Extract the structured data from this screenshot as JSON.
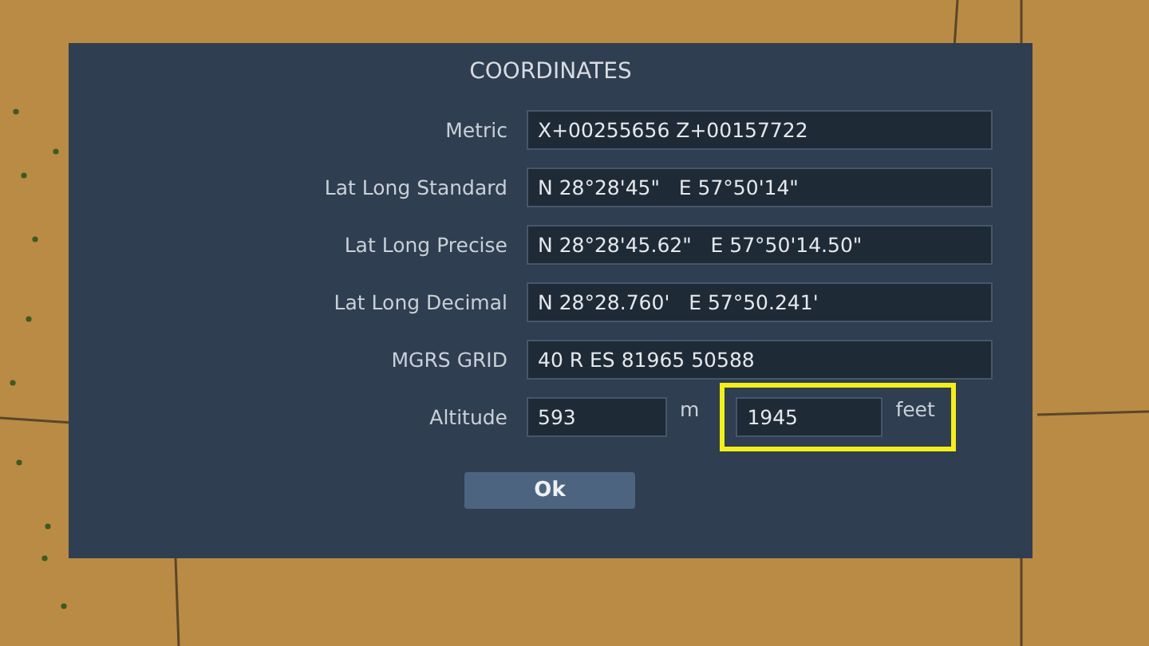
{
  "dialog": {
    "title": "COORDINATES",
    "rows": [
      {
        "label": "Metric",
        "value": "X+00255656 Z+00157722"
      },
      {
        "label": "Lat Long Standard",
        "value": "N 28°28'45\"   E 57°50'14\""
      },
      {
        "label": "Lat Long Precise",
        "value": "N 28°28'45.62\"   E 57°50'14.50\""
      },
      {
        "label": "Lat Long Decimal",
        "value": "N 28°28.760'   E 57°50.241'"
      },
      {
        "label": "MGRS GRID",
        "value": "40 R ES 81965 50588"
      }
    ],
    "altitude": {
      "label": "Altitude",
      "fields": [
        {
          "value": "593",
          "unit": "m",
          "highlighted": false
        },
        {
          "value": "1945",
          "unit": "feet",
          "highlighted": true
        }
      ]
    },
    "ok_button": "Ok"
  }
}
